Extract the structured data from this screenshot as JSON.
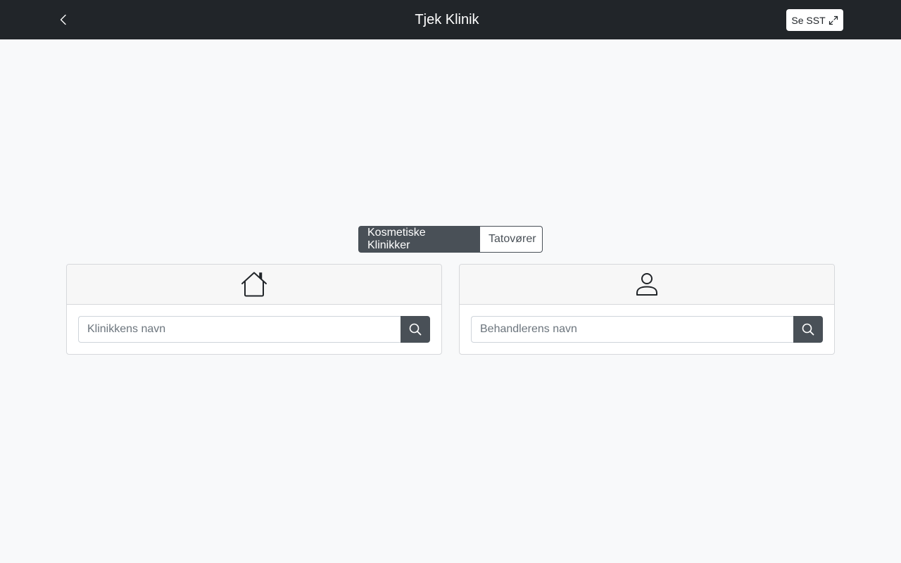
{
  "header": {
    "title": "Tjek Klinik",
    "back_icon": "chevron-left-icon",
    "sst_button_label": "Se SST",
    "sst_icon": "expand-arrows-icon"
  },
  "toggle": {
    "options": [
      {
        "label": "Kosmetiske Klinikker",
        "active": true
      },
      {
        "label": "Tatovører",
        "active": false
      }
    ]
  },
  "cards": {
    "clinic": {
      "icon": "house-icon",
      "placeholder": "Klinikkens navn",
      "search_icon": "search-icon"
    },
    "practitioner": {
      "icon": "person-icon",
      "placeholder": "Behandlerens navn",
      "search_icon": "search-icon"
    }
  },
  "colors": {
    "navbar": "#212529",
    "background": "#f8f9fa",
    "accent": "#495057"
  }
}
